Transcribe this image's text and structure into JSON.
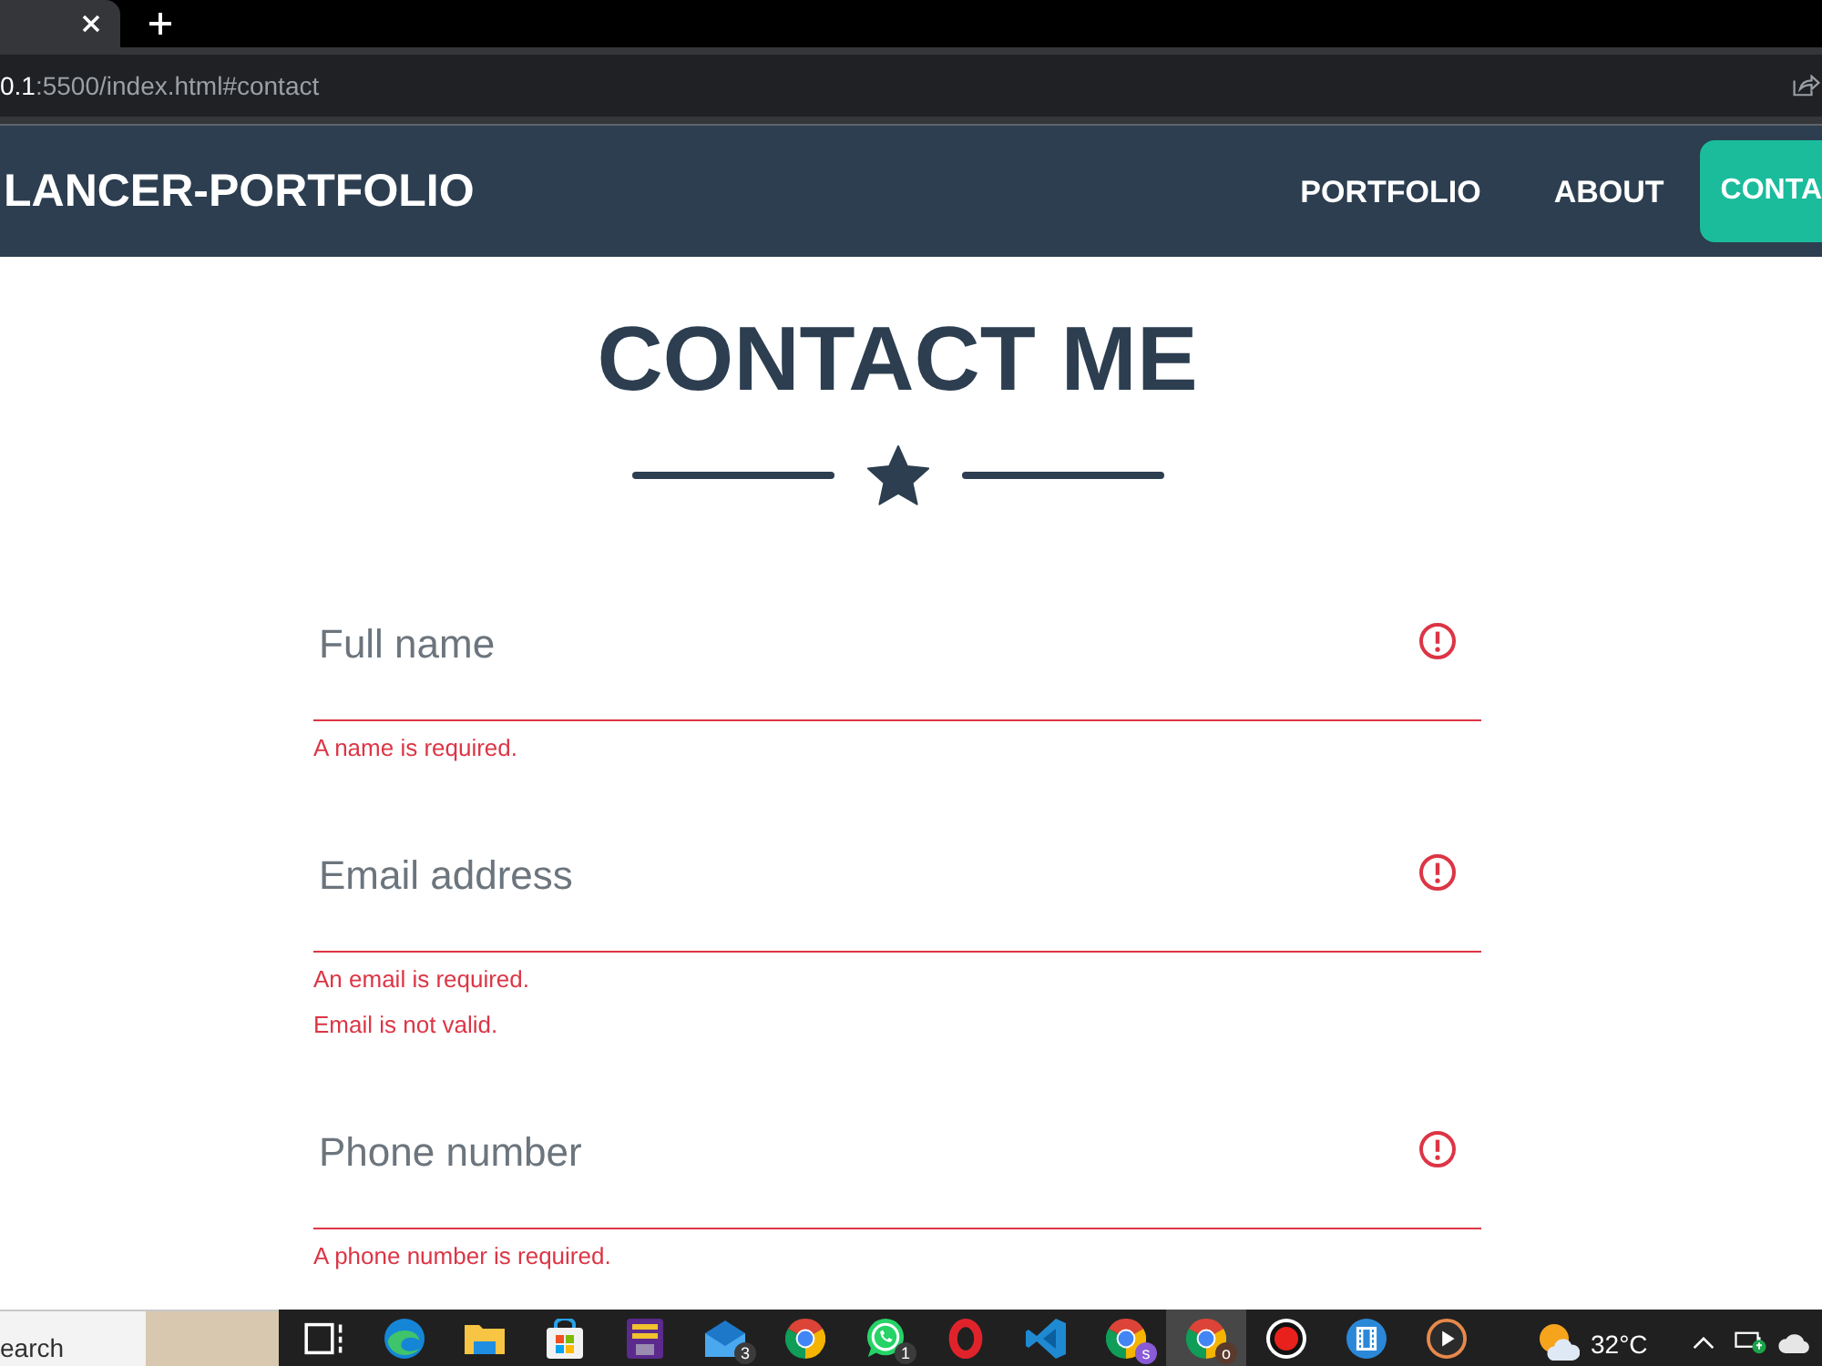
{
  "address_bar": {
    "host": "0.1",
    "path": ":5500/index.html#contact"
  },
  "navbar": {
    "brand": "LANCER-PORTFOLIO",
    "links": [
      {
        "label": "PORTFOLIO",
        "selected": false
      },
      {
        "label": "ABOUT",
        "selected": false
      },
      {
        "label": "CONTA",
        "selected": true
      }
    ]
  },
  "contact": {
    "title": "CONTACT ME",
    "fields": [
      {
        "placeholder": "Full name",
        "invalid": true,
        "errors": [
          "A name is required."
        ]
      },
      {
        "placeholder": "Email address",
        "invalid": true,
        "errors": [
          "An email is required.",
          "Email is not valid."
        ]
      },
      {
        "placeholder": "Phone number",
        "invalid": true,
        "errors": [
          "A phone number is required."
        ]
      }
    ]
  },
  "taskbar": {
    "search": {
      "placeholder": "earch"
    },
    "apps": [
      {
        "kind": "taskview",
        "selected": false
      },
      {
        "kind": "swirl",
        "selected": false
      },
      {
        "kind": "folder",
        "selected": false
      },
      {
        "kind": "bag",
        "selected": false
      },
      {
        "kind": "poster",
        "selected": false
      },
      {
        "kind": "envelope",
        "selected": false,
        "badge": {
          "text": "3",
          "color": "#3b3b3b"
        }
      },
      {
        "kind": "wheel",
        "selected": false
      },
      {
        "kind": "chat",
        "selected": false,
        "badge": {
          "text": "1",
          "color": "#3b3b3b"
        }
      },
      {
        "kind": "ring",
        "selected": false
      },
      {
        "kind": "code",
        "selected": false
      },
      {
        "kind": "wheel",
        "selected": false,
        "badge": {
          "text": "s",
          "color": "#8a5bd6"
        }
      },
      {
        "kind": "wheel",
        "selected": true,
        "badge": {
          "text": "o",
          "color": "#5a3a2c"
        }
      },
      {
        "kind": "record",
        "selected": false
      },
      {
        "kind": "film",
        "selected": false
      },
      {
        "kind": "play",
        "selected": false
      }
    ],
    "temperature": "32°C"
  }
}
